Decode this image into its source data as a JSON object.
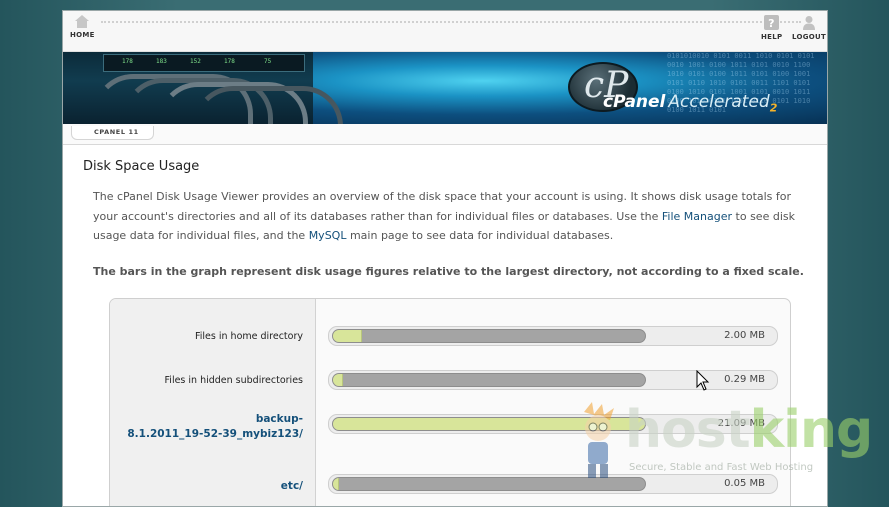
{
  "nav": {
    "home_label": "HOME",
    "help_label": "HELP",
    "logout_label": "LOGOUT"
  },
  "banner": {
    "brand_main": "cPanel",
    "brand_sub": "Accelerated",
    "brand_num": "2",
    "logo_letter": "cP",
    "led1": "178",
    "led2": "183",
    "led3": "152",
    "led4": "178",
    "led5": "75"
  },
  "version_tab": "CPANEL 11",
  "page": {
    "title": "Disk Space Usage",
    "intro_1": "The cPanel Disk Usage Viewer provides an overview of the disk space that your account is using. It shows disk usage totals for your account's directories and all of its databases rather than for individual files or databases. Use the ",
    "file_manager_link": "File Manager",
    "intro_2": " to see disk usage data for individual files, and the ",
    "mysql_link": "MySQL",
    "intro_3": " main page to see data for individual databases.",
    "note": "The bars in the graph represent disk usage figures relative to the largest directory, not according to a fixed scale."
  },
  "usage_rows": [
    {
      "label": "Files in home directory",
      "size": "2.00 MB",
      "fill_fraction": 0.09
    },
    {
      "label": "Files in hidden subdirectories",
      "size": "0.29 MB",
      "fill_fraction": 0.03
    },
    {
      "label": "backup-\n8.1.2011_19-52-39_mybiz123/",
      "size": "21.09 MB",
      "fill_fraction": 1.0
    },
    {
      "label": "etc/",
      "size": "0.05 MB",
      "fill_fraction": 0.01
    }
  ],
  "watermark": {
    "host": "host",
    "king": "king",
    "tagline": "Secure, Stable and Fast Web Hosting"
  },
  "colors": {
    "link": "#14507a",
    "bar_fill": "#d8e59a",
    "bar_track": "#a4a4a4",
    "background": "#3a6d73"
  }
}
